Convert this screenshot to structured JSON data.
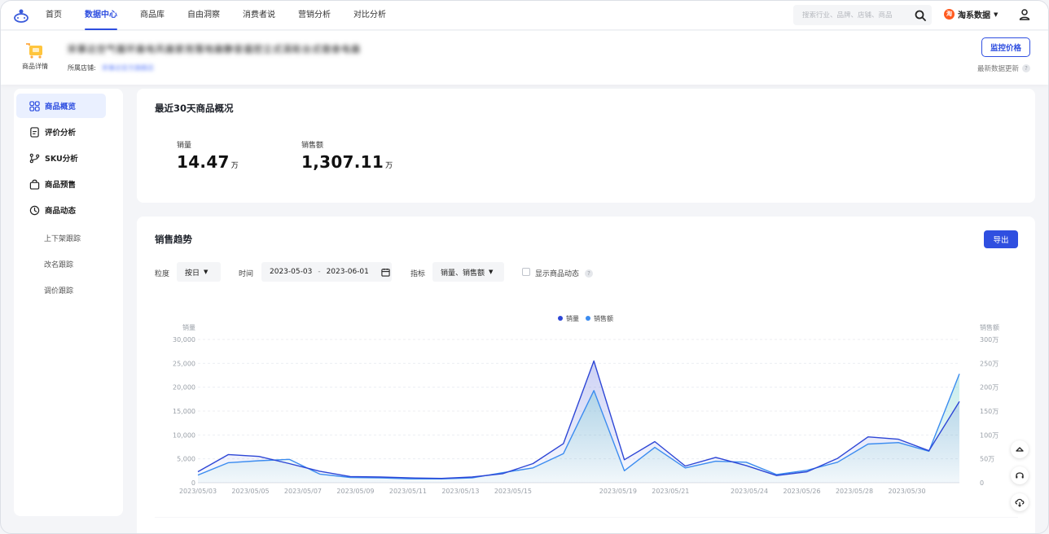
{
  "nav": {
    "items": [
      {
        "label": "首页",
        "active": false
      },
      {
        "label": "数据中心",
        "active": true
      },
      {
        "label": "商品库",
        "active": false
      },
      {
        "label": "自由洞察",
        "active": false
      },
      {
        "label": "消费者说",
        "active": false
      },
      {
        "label": "营销分析",
        "active": false
      },
      {
        "label": "对比分析",
        "active": false
      }
    ],
    "search_placeholder": "搜索行业、品牌、店铺、商品",
    "brand_logo": "淘",
    "brand": "淘系数据"
  },
  "product": {
    "icon_label": "商品详情",
    "title": "宋事达空气循环扇电风扇家用落地扇静音遥控立式涡轮台式宿舍电扇",
    "shop_label": "所属店铺:",
    "shop_name": "宋事达官方旗舰店",
    "monitor_label": "监控价格",
    "update_text": "最新数据更新"
  },
  "sidebar": {
    "items": [
      {
        "label": "商品概览",
        "icon": "grid-icon",
        "active": true
      },
      {
        "label": "评价分析",
        "icon": "document-icon",
        "active": false
      },
      {
        "label": "SKU分析",
        "icon": "branch-icon",
        "active": false
      },
      {
        "label": "商品预售",
        "icon": "bag-icon",
        "active": false
      },
      {
        "label": "商品动态",
        "icon": "clock-icon",
        "active": false
      }
    ],
    "subitems": [
      "上下架跟踪",
      "改名跟踪",
      "调价跟踪"
    ]
  },
  "overview": {
    "title": "最近30天商品概况",
    "metrics": [
      {
        "label": "销量",
        "value": "14.47",
        "unit": "万"
      },
      {
        "label": "销售额",
        "value": "1,307.11",
        "unit": "万"
      }
    ]
  },
  "trend": {
    "title": "销售趋势",
    "export_label": "导出",
    "granularity_label": "粒度",
    "granularity_value": "按日",
    "time_label": "时间",
    "date_start": "2023-05-03",
    "date_sep": "-",
    "date_end": "2023-06-01",
    "metric_label": "指标",
    "metric_value": "销量、销售额",
    "show_dynamics_label": "显示商品动态"
  },
  "chart_data": {
    "type": "line",
    "legend_position": "top-center",
    "grid": true,
    "ylabel_left": "销量",
    "ylabel_right": "销售额",
    "ylim_left": [
      0,
      30000
    ],
    "ylim_right": [
      0,
      300
    ],
    "left_ticks": [
      "0",
      "5,000",
      "10,000",
      "15,000",
      "20,000",
      "25,000",
      "30,000"
    ],
    "right_ticks": [
      "0",
      "50万",
      "100万",
      "150万",
      "200万",
      "250万",
      "300万"
    ],
    "x": [
      "2023/05/03",
      "2023/05/04",
      "2023/05/05",
      "2023/05/06",
      "2023/05/07",
      "2023/05/08",
      "2023/05/09",
      "2023/05/10",
      "2023/05/11",
      "2023/05/12",
      "2023/05/13",
      "2023/05/14",
      "2023/05/15",
      "2023/05/16",
      "2023/05/17",
      "2023/05/18",
      "2023/05/19",
      "2023/05/20",
      "2023/05/21",
      "2023/05/22",
      "2023/05/23",
      "2023/05/24",
      "2023/05/25",
      "2023/05/26",
      "2023/05/27",
      "2023/05/28",
      "2023/05/29",
      "2023/05/30",
      "2023/05/31",
      "2023/06/01"
    ],
    "x_tick_labels": [
      "2023/05/03",
      "2023/05/05",
      "2023/05/07",
      "2023/05/09",
      "2023/05/11",
      "2023/05/13",
      "2023/05/15",
      "2023/05/19",
      "2023/05/21",
      "2023/05/24",
      "2023/05/26",
      "2023/05/28",
      "2023/05/30"
    ],
    "series": [
      {
        "name": "销量",
        "axis": "left",
        "color": "#2d46d6",
        "values": [
          2300,
          5900,
          5500,
          4000,
          2400,
          1300,
          1200,
          1000,
          900,
          1200,
          1900,
          4000,
          8200,
          25500,
          4800,
          8600,
          3500,
          5300,
          3600,
          1500,
          2300,
          5100,
          9600,
          9100,
          6700,
          17000
        ]
      },
      {
        "name": "销售额",
        "axis": "right",
        "color": "#3b8cf0",
        "values": [
          16,
          42,
          46,
          49,
          18,
          11,
          10,
          8,
          8,
          10,
          21,
          31,
          61,
          193,
          25,
          74,
          31,
          45,
          43,
          17,
          26,
          43,
          81,
          84,
          66,
          228
        ]
      }
    ]
  },
  "colors": {
    "primary": "#2f4fe0",
    "series_qty": "#2d46d6",
    "series_sales": "#3b8cf0"
  }
}
